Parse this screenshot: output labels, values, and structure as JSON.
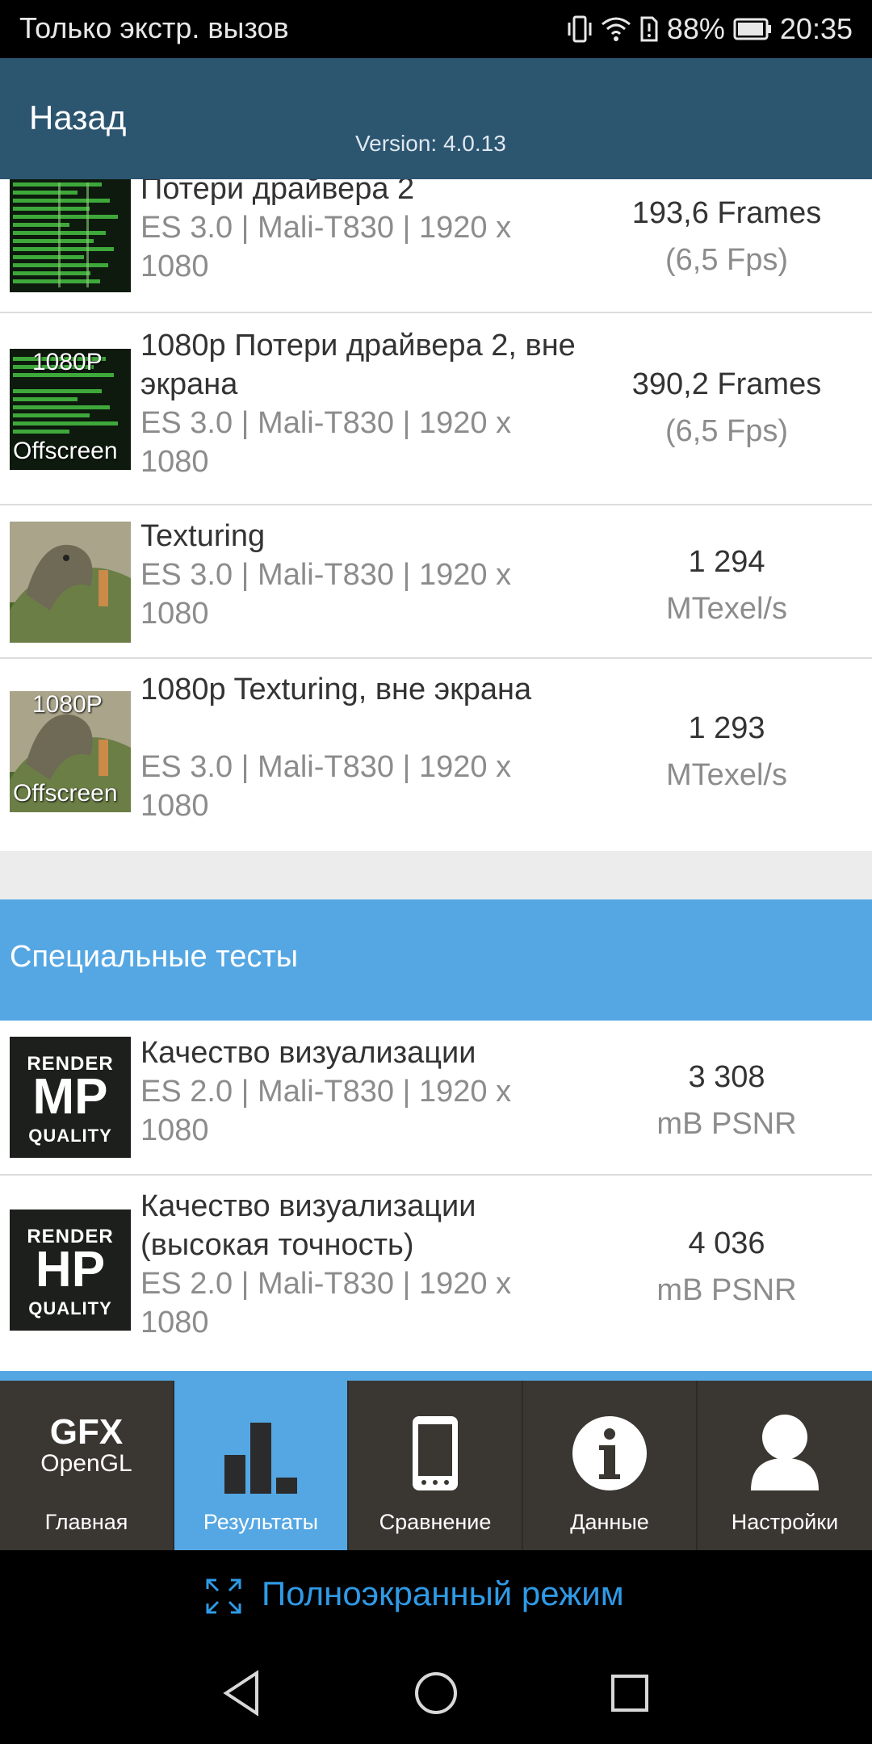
{
  "status_bar": {
    "carrier_text": "Только экстр. вызов",
    "battery_percent": "88%",
    "time": "20:35"
  },
  "header": {
    "back_label": "Назад",
    "version": "Version: 4.0.13"
  },
  "results": [
    {
      "title": "Потери драйвера 2",
      "subtitle": "ES 3.0 | Mali-T830 | 1920 x 1080",
      "score": "193,6 Frames",
      "unit": "(6,5 Fps)"
    },
    {
      "title": "1080p Потери драйвера 2, вне экрана",
      "subtitle": "ES 3.0 | Mali-T830 | 1920 x 1080",
      "score": "390,2 Frames",
      "unit": "(6,5 Fps)",
      "thumb_top": "1080P",
      "thumb_bottom": "Offscreen"
    },
    {
      "title": "Texturing",
      "subtitle": "ES 3.0 | Mali-T830 | 1920 x 1080",
      "score": "1 294",
      "unit": "MTexel/s"
    },
    {
      "title": "1080p Texturing, вне экрана",
      "subtitle": "ES 3.0 | Mali-T830 | 1920 x 1080",
      "score": "1 293",
      "unit": "MTexel/s",
      "thumb_top": "1080P",
      "thumb_bottom": "Offscreen"
    }
  ],
  "special_section": {
    "title": "Специальные тесты",
    "items": [
      {
        "title": "Качество визуализации",
        "subtitle": "ES 2.0 | Mali-T830 | 1920 x 1080",
        "score": "3 308",
        "unit": "mB PSNR",
        "badge_top": "RENDER",
        "badge_mid": "MP",
        "badge_bottom": "QUALITY"
      },
      {
        "title": "Качество визуализации (высокая точность)",
        "subtitle": "ES 2.0 | Mali-T830 | 1920 x 1080",
        "score": "4 036",
        "unit": "mB PSNR",
        "badge_top": "RENDER",
        "badge_mid": "HP",
        "badge_bottom": "QUALITY"
      }
    ]
  },
  "bottom_nav": {
    "home_logo_top": "GFX",
    "home_logo_bottom": "OpenGL",
    "items": [
      {
        "label": "Главная",
        "icon": "gfx-logo-icon"
      },
      {
        "label": "Результаты",
        "icon": "bar-chart-icon",
        "active": true
      },
      {
        "label": "Сравнение",
        "icon": "phone-icon"
      },
      {
        "label": "Данные",
        "icon": "info-icon"
      },
      {
        "label": "Настройки",
        "icon": "user-icon"
      }
    ]
  },
  "fullscreen": {
    "label": "Полноэкранный режим"
  },
  "colors": {
    "header": "#2c5570",
    "accent": "#55a7e3",
    "nav_bg": "#3a3632",
    "fullscreen_text": "#2f9ae6"
  }
}
